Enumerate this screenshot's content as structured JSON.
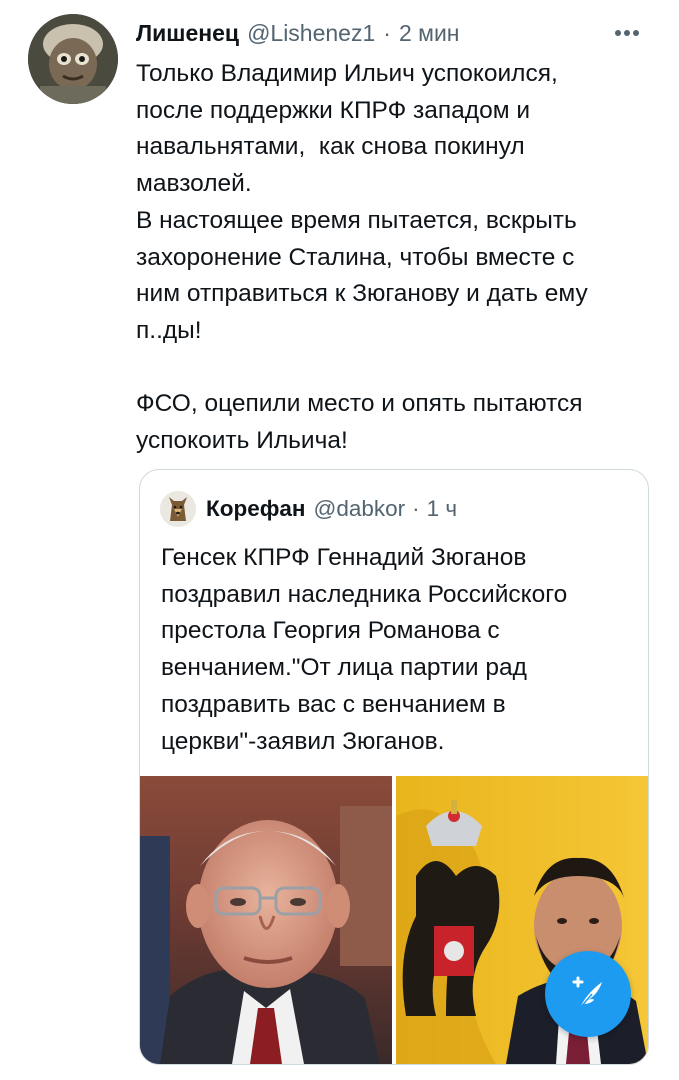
{
  "tweet": {
    "author_name": "Лишенец",
    "author_handle": "@Lishenez1",
    "separator": "·",
    "time": "2 мин",
    "more_icon": "more-horizontal-icon",
    "body_lines": [
      "Только Владимир Ильич успокоился,",
      "после поддержки КПРФ западом и",
      "навальнятами,  как снова покинул",
      "мавзолей.",
      "В настоящее время пытается, вскрыть",
      "захоронение Сталина, чтобы вместе с",
      "ним отправиться к Зюганову и дать ему",
      "п..ды!",
      "",
      "ФСО, оцепили место и опять пытаются",
      "успокоить Ильича!"
    ]
  },
  "quote": {
    "author_name": "Корефан",
    "author_handle": "@dabkor",
    "separator": "·",
    "time": "1 ч",
    "body_lines": [
      "Генсек КПРФ Геннадий Зюганов",
      "поздравил наследника Российского",
      "престола Георгия Романова с",
      "венчанием.\"От лица партии рад",
      "поздравить вас с венчанием в",
      "церкви\"-заявил Зюганов."
    ],
    "media_count": 2
  },
  "compose_button": {
    "icon": "compose-feather-plus-icon",
    "color": "#1d9bf0"
  },
  "colors": {
    "text_primary": "#0f1419",
    "text_secondary": "#536471",
    "accent": "#1d9bf0",
    "border": "#cfd9de"
  }
}
